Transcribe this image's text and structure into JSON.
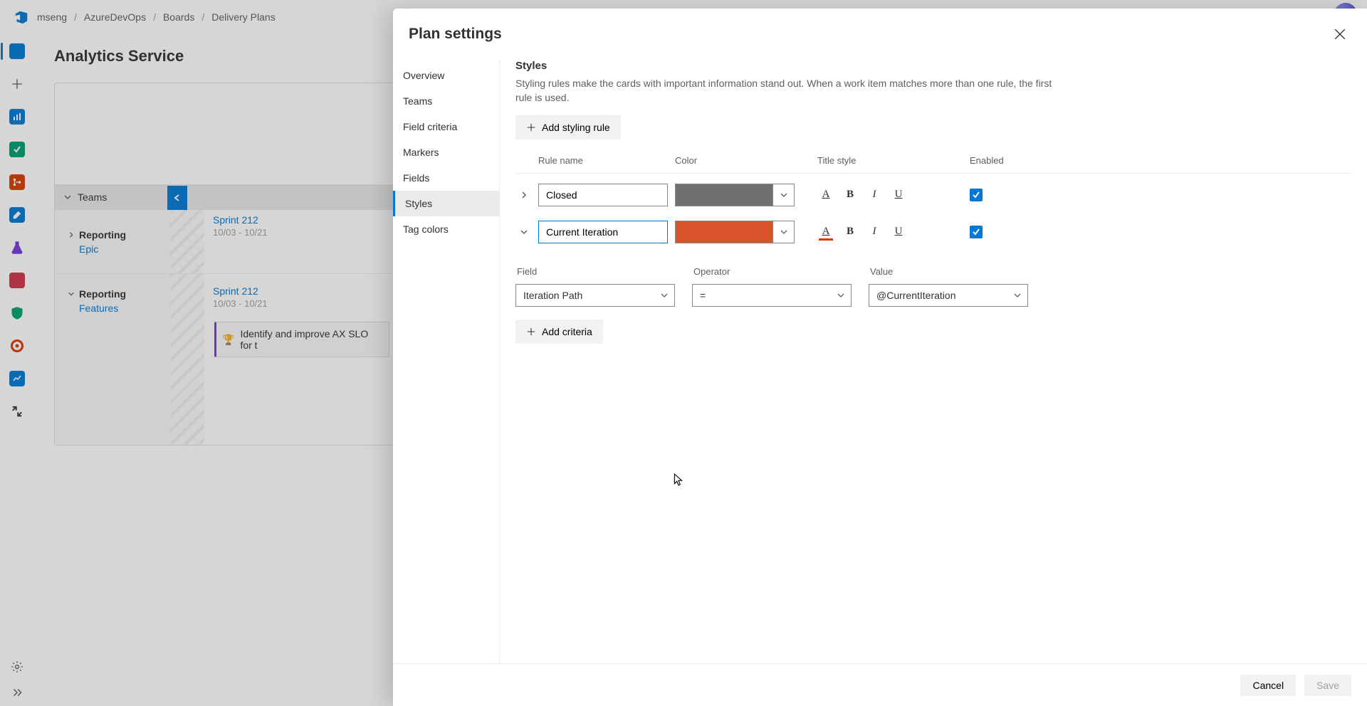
{
  "breadcrumb": [
    "mseng",
    "AzureDevOps",
    "Boards",
    "Delivery Plans"
  ],
  "page": {
    "title": "Analytics Service"
  },
  "leftRail": {
    "items": [
      {
        "name": "project-icon",
        "color": "#0078d4"
      },
      {
        "name": "add-icon",
        "color": "#605e5c"
      },
      {
        "name": "dashboard-icon",
        "color": "#0078d4"
      },
      {
        "name": "boards-icon",
        "color": "#00a36a"
      },
      {
        "name": "repos-icon",
        "color": "#d83b01"
      },
      {
        "name": "pipelines-icon",
        "color": "#0078d4"
      },
      {
        "name": "flask-icon",
        "color": "#773adc"
      },
      {
        "name": "artifacts-icon",
        "color": "#d1344b"
      },
      {
        "name": "shields-icon",
        "color": "#00a36a"
      },
      {
        "name": "cycle-icon",
        "color": "#d83b01"
      },
      {
        "name": "chart-icon",
        "color": "#0078d4"
      },
      {
        "name": "branch-icon",
        "color": "#323130"
      }
    ]
  },
  "board": {
    "teamsHeader": "Teams",
    "rows": [
      {
        "title": "Reporting",
        "subtitle": "Epic",
        "sprintName": "Sprint 212",
        "sprintDates": "10/03 - 10/21"
      },
      {
        "title": "Reporting",
        "subtitle": "Features",
        "sprintName": "Sprint 212",
        "sprintDates": "10/03 - 10/21"
      }
    ],
    "card": {
      "text": "Identify and improve AX SLO for t"
    }
  },
  "panel": {
    "title": "Plan settings",
    "nav": [
      "Overview",
      "Teams",
      "Field criteria",
      "Markers",
      "Fields",
      "Styles",
      "Tag colors"
    ],
    "navSelected": "Styles",
    "styles": {
      "heading": "Styles",
      "description": "Styling rules make the cards with important information stand out. When a work item matches more than one rule, the first rule is used.",
      "addButton": "Add styling rule",
      "columns": {
        "rule": "Rule name",
        "color": "Color",
        "titleStyle": "Title style",
        "enabled": "Enabled"
      },
      "rules": [
        {
          "expanded": false,
          "name": "Closed",
          "color": "#707070",
          "accent": false,
          "enabled": true
        },
        {
          "expanded": true,
          "name": "Current Iteration",
          "color": "#d8552c",
          "accent": true,
          "enabled": true
        }
      ],
      "criteria": {
        "header": {
          "field": "Field",
          "operator": "Operator",
          "value": "Value"
        },
        "field": "Iteration Path",
        "operator": "=",
        "value": "@CurrentIteration",
        "addButton": "Add criteria"
      }
    },
    "footer": {
      "cancel": "Cancel",
      "save": "Save"
    }
  }
}
